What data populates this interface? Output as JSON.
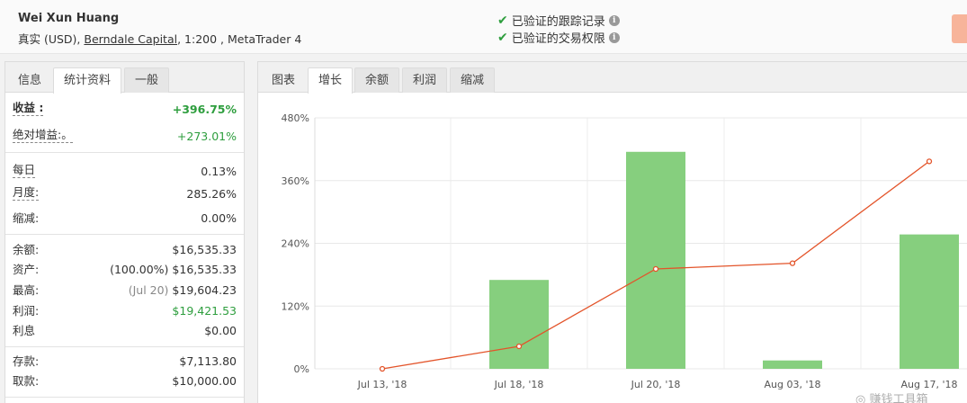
{
  "header": {
    "name": "Wei Xun Huang",
    "account_type": "真实 (USD),",
    "broker": "Berndale Capital",
    "details": ", 1:200 , MetaTrader 4",
    "verified": [
      {
        "label": "已验证的跟踪记录"
      },
      {
        "label": "已验证的交易权限"
      }
    ]
  },
  "left_tabs": [
    "信息",
    "统计资料",
    "一般"
  ],
  "stats": {
    "gain": {
      "label": "收益 :",
      "value": "+396.75%"
    },
    "abs_gain": {
      "label": "绝对增益:。",
      "value": "+273.01%"
    },
    "daily": {
      "label": "每日",
      "value": "0.13%"
    },
    "monthly": {
      "label": "月度:",
      "value": "285.26%"
    },
    "drawdown": {
      "label": "缩减:",
      "value": "0.00%"
    },
    "balance": {
      "label": "余额:",
      "value": "$16,535.33"
    },
    "equity": {
      "label": "资产:",
      "value_pre": "(100.00%)",
      "value": "$16,535.33"
    },
    "highest": {
      "label": "最高:",
      "value_pre": "(Jul 20)",
      "value": "$19,604.23"
    },
    "profit": {
      "label": "利润:",
      "value": "$19,421.53"
    },
    "interest": {
      "label": "利息",
      "value": "$0.00"
    },
    "deposits": {
      "label": "存款:",
      "value": "$7,113.80"
    },
    "withdrawals": {
      "label": "取款:",
      "value": "$10,000.00"
    }
  },
  "right_tabs": [
    "图表",
    "增长",
    "余额",
    "利润",
    "缩减"
  ],
  "chart_data": {
    "type": "bar",
    "categories": [
      "Jul 13, '18",
      "Jul 18, '18",
      "Jul 20, '18",
      "Aug 03, '18",
      "Aug 17, '18"
    ],
    "series": [
      {
        "type": "bar",
        "values": [
          0,
          170,
          415,
          16,
          257
        ],
        "color": "#86cf7e"
      },
      {
        "type": "line",
        "values": [
          0,
          43,
          191,
          202,
          396.75
        ],
        "color": "#e3542a"
      }
    ],
    "yticks": [
      "0%",
      "120%",
      "240%",
      "360%",
      "480%"
    ],
    "ylim": [
      0,
      480
    ]
  },
  "watermark": "赚钱工具箱",
  "colors": {
    "green": "#2e9e3e",
    "bar": "#86cf7e",
    "line": "#e3542a"
  }
}
